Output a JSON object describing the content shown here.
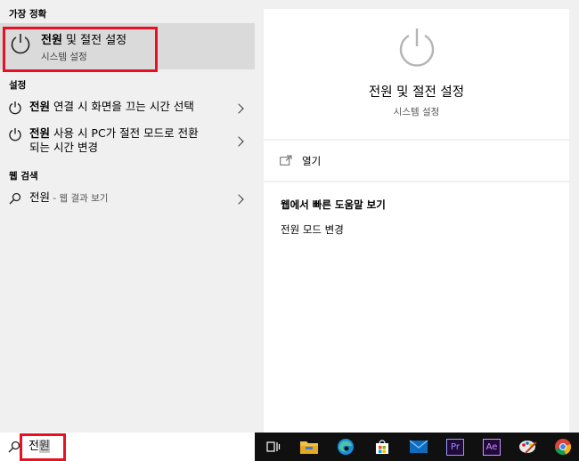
{
  "left": {
    "best_match_header": "가장 정확",
    "best_match": {
      "title_bold": "전원",
      "title_rest": " 및 절전 설정",
      "subtitle": "시스템 설정"
    },
    "settings_header": "설정",
    "settings_items": [
      {
        "bold": "전원",
        "rest": " 연결 시 화면을 끄는 시간 선택"
      },
      {
        "bold": "전원",
        "rest": " 사용 시 PC가 절전 모드로 전환",
        "line2": "되는 시간 변경"
      }
    ],
    "web_header": "웹 검색",
    "web_item": {
      "term": "전원",
      "suffix": " - 웹 결과 보기"
    }
  },
  "preview": {
    "title": "전원 및 절전 설정",
    "subtitle": "시스템 설정",
    "open_label": "열기",
    "help_header": "웹에서 빠른 도움말 보기",
    "help_link": "전원 모드 변경"
  },
  "search": {
    "typed": "전",
    "composing": "원"
  },
  "taskbar": {
    "icons": [
      "task-view-icon",
      "file-explorer-icon",
      "edge-icon",
      "store-icon",
      "mail-icon",
      "premiere-icon",
      "after-effects-icon",
      "paint-icon",
      "chrome-icon"
    ],
    "premiere_label": "Pr",
    "ae_label": "Ae"
  },
  "colors": {
    "highlight_border": "#e81123",
    "selected_bg": "#dadada",
    "taskbar_bg": "#101010"
  }
}
